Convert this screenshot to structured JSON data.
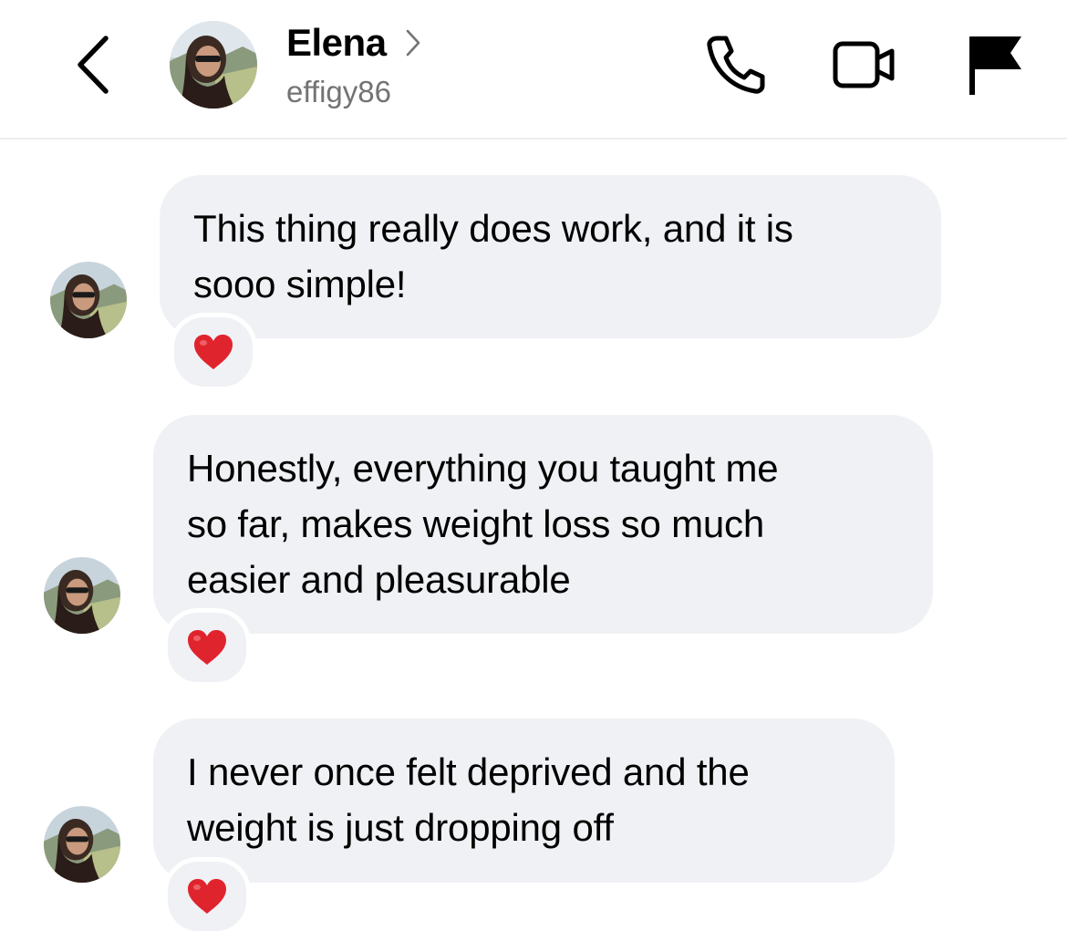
{
  "header": {
    "contact_name": "Elena",
    "username": "effigy86",
    "icons": {
      "back": "chevron-left-icon",
      "profile_link": "chevron-right-icon",
      "call": "phone-icon",
      "video": "video-camera-icon",
      "report": "flag-icon"
    }
  },
  "messages": [
    {
      "lines": [
        "This thing really does work, and it is",
        "sooo simple!"
      ],
      "reaction": "heart"
    },
    {
      "lines": [
        "Honestly, everything you taught me",
        "so far, makes weight loss so much",
        "easier and pleasurable"
      ],
      "reaction": "heart"
    },
    {
      "lines": [
        "I never once felt deprived and the",
        "weight is just dropping off"
      ],
      "reaction": "heart"
    }
  ],
  "colors": {
    "bubble": "#eff1f4",
    "username": "#737373",
    "heart": "#e0242e"
  }
}
